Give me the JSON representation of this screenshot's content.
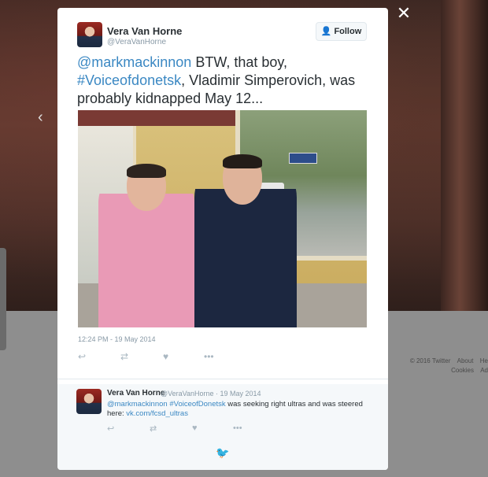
{
  "close_label": "✕",
  "nav": {
    "prev_icon": "‹"
  },
  "tweet": {
    "author_name": "Vera Van Horne",
    "author_handle": "@VeraVanHorne",
    "follow_label": "Follow",
    "text_parts": [
      "@markmackinnon",
      " BTW, that boy, ",
      "#Voiceofdonetsk",
      ", Vladimir Simperovich, was probably kidnapped May 12..."
    ],
    "timestamp": "12:24 PM - 19 May 2014",
    "photo_alt": "Two men standing in front of a storefront"
  },
  "reply": {
    "author_name": "Vera Van Horne",
    "meta": "@VeraVanHorne · 19 May 2014",
    "text_parts": [
      "@markmackinnon",
      " ",
      "#VoiceofDonetsk",
      " was seeking right ultras and was steered here: ",
      "vk.com/fcsd_ultras"
    ]
  },
  "footer": {
    "copyright": "© 2016 Twitter",
    "about": "About",
    "help": "He",
    "cookies": "Cookies",
    "ads": "Ad"
  },
  "colors": {
    "link": "#3b88c3",
    "text": "#292f33",
    "muted": "#8899a6"
  }
}
